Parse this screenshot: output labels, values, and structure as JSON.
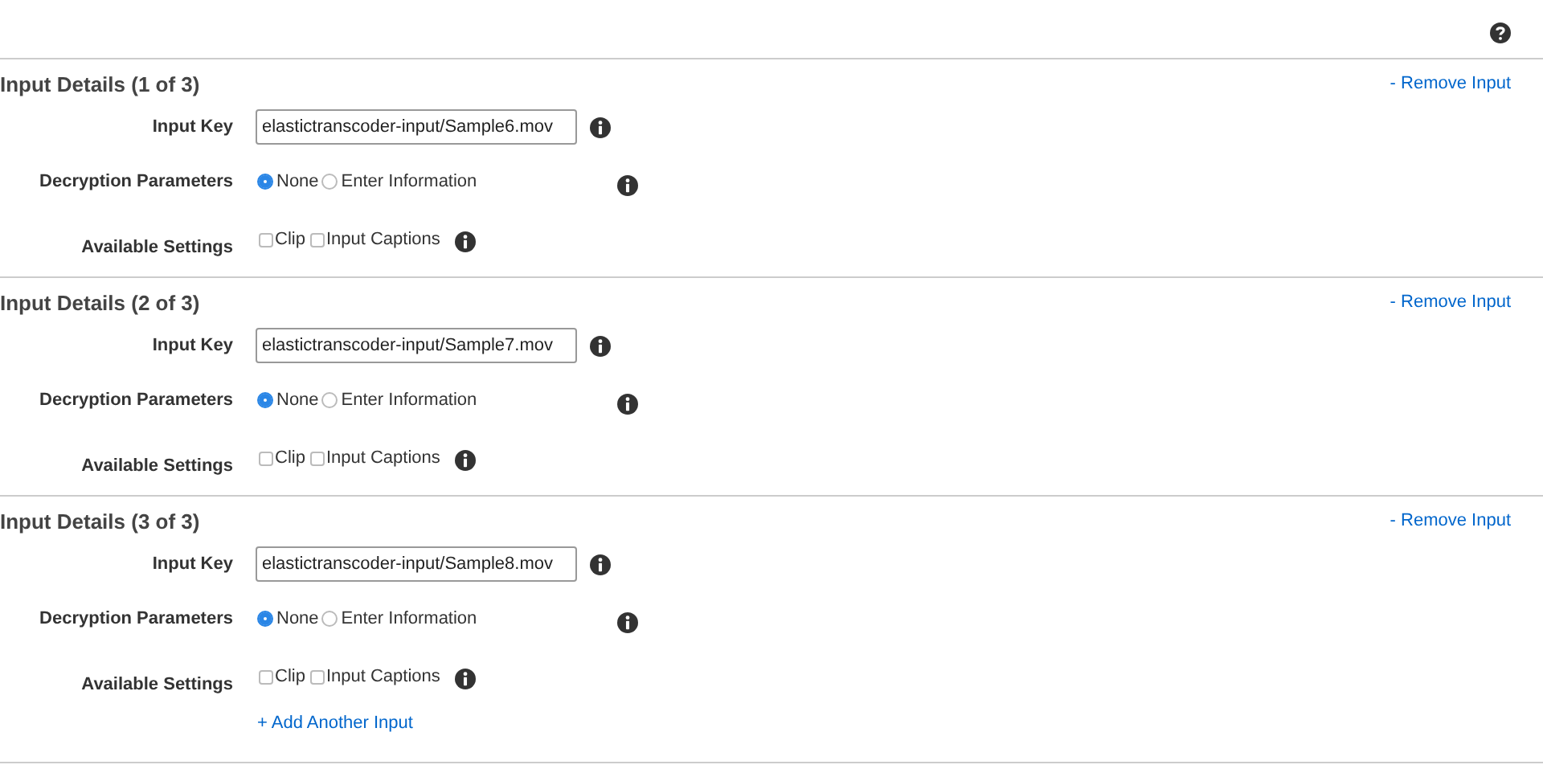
{
  "sections": [
    {
      "title": "Input Details (1 of 3)",
      "remove_link": "- Remove Input",
      "input_key": {
        "label": "Input Key",
        "value": "elastictranscoder-input/Sample6.mov"
      },
      "decryption": {
        "label": "Decryption Parameters",
        "options": [
          {
            "label": "None",
            "selected": true
          },
          {
            "label": "Enter Information",
            "selected": false
          }
        ]
      },
      "settings": {
        "label": "Available Settings",
        "options": [
          {
            "label": "Clip",
            "checked": false
          },
          {
            "label": "Input Captions",
            "checked": false
          }
        ]
      }
    },
    {
      "title": "Input Details (2 of 3)",
      "remove_link": "- Remove Input",
      "input_key": {
        "label": "Input Key",
        "value": "elastictranscoder-input/Sample7.mov"
      },
      "decryption": {
        "label": "Decryption Parameters",
        "options": [
          {
            "label": "None",
            "selected": true
          },
          {
            "label": "Enter Information",
            "selected": false
          }
        ]
      },
      "settings": {
        "label": "Available Settings",
        "options": [
          {
            "label": "Clip",
            "checked": false
          },
          {
            "label": "Input Captions",
            "checked": false
          }
        ]
      }
    },
    {
      "title": "Input Details (3 of 3)",
      "remove_link": "- Remove Input",
      "input_key": {
        "label": "Input Key",
        "value": "elastictranscoder-input/Sample8.mov"
      },
      "decryption": {
        "label": "Decryption Parameters",
        "options": [
          {
            "label": "None",
            "selected": true
          },
          {
            "label": "Enter Information",
            "selected": false
          }
        ]
      },
      "settings": {
        "label": "Available Settings",
        "options": [
          {
            "label": "Clip",
            "checked": false
          },
          {
            "label": "Input Captions",
            "checked": false
          }
        ]
      }
    }
  ],
  "add_link": "+ Add Another Input"
}
